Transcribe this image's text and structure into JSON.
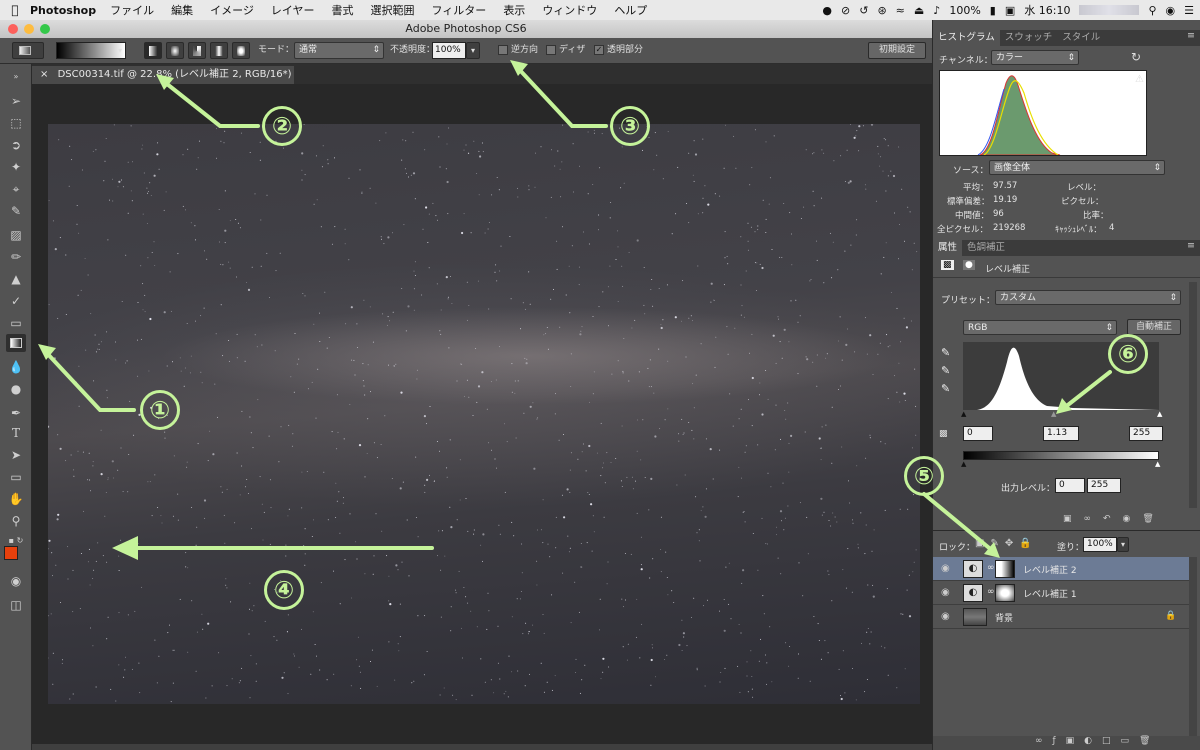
{
  "mac_menubar": {
    "app_name": "Photoshop",
    "items": [
      "ファイル",
      "編集",
      "イメージ",
      "レイヤー",
      "書式",
      "選択範囲",
      "フィルター",
      "表示",
      "ウィンドウ",
      "ヘルプ"
    ],
    "battery": "100%",
    "clock": "水 16:10"
  },
  "window": {
    "title": "Adobe Photoshop CS6"
  },
  "options_bar": {
    "mode_label": "モード：",
    "mode_value": "通常",
    "opacity_label": "不透明度：",
    "opacity_value": "100%",
    "reverse_label": "逆方向",
    "dither_label": "ディザ",
    "transparency_label": "透明部分",
    "reset_button": "初期設定"
  },
  "document_tab": {
    "title": "DSC00314.tif @ 22.8% (レベル補正 2, RGB/16*) *"
  },
  "histogram_panel": {
    "tabs": [
      "ヒストグラム",
      "スウォッチ",
      "スタイル"
    ],
    "channel_label": "チャンネル：",
    "channel_value": "カラー",
    "source_label": "ソース：",
    "source_value": "画像全体",
    "stats": {
      "mean_label": "平均：",
      "mean_value": "97.57",
      "std_label": "標準偏差：",
      "std_value": "19.19",
      "median_label": "中間値：",
      "median_value": "96",
      "pixels_label": "全ピクセル：",
      "pixels_value": "219268",
      "level_label": "レベル：",
      "count_label": "ピクセル：",
      "percent_label": "比率：",
      "cache_label": "ｷｬｯｼｭﾚﾍﾞﾙ：",
      "cache_value": "4"
    }
  },
  "properties_panel": {
    "tabs": [
      "属性",
      "色調補正"
    ],
    "header": "レベル補正",
    "preset_label": "プリセット：",
    "preset_value": "カスタム",
    "channel_value": "RGB",
    "auto_button": "自動補正",
    "input_black": "0",
    "input_gamma": "1.13",
    "input_white": "255",
    "output_label": "出力レベル：",
    "output_black": "0",
    "output_white": "255"
  },
  "layers_panel": {
    "lock_label": "ロック：",
    "fill_label": "塗り：",
    "fill_value": "100%",
    "layers": [
      {
        "name": "レベル補正 2"
      },
      {
        "name": "レベル補正 1"
      },
      {
        "name": "背景"
      }
    ]
  },
  "annotations": [
    "①",
    "②",
    "③",
    "④",
    "⑤",
    "⑥"
  ],
  "colors": {
    "annotation": "#c5f39a",
    "foreground": "#e8400c",
    "background": "#ffffff",
    "selected_layer": "#6c7b95"
  }
}
